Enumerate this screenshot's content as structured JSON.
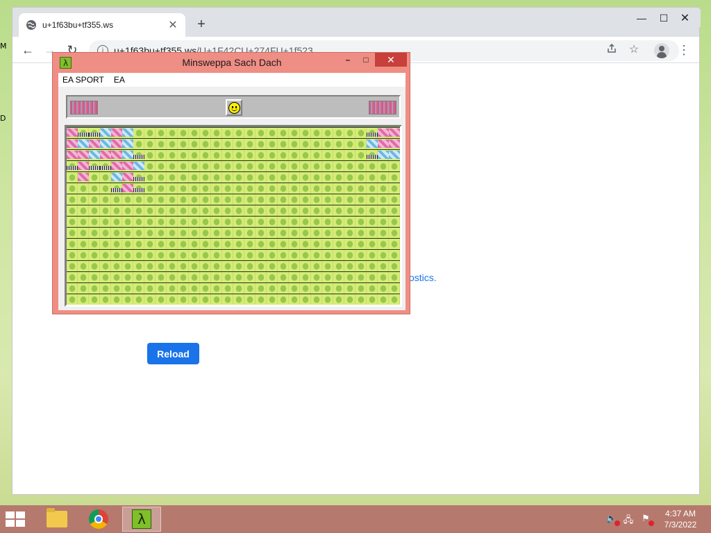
{
  "desktop": {
    "letter_m": "M",
    "letter_d": "D"
  },
  "browser": {
    "tab_title": "u+1f63bu+tf355.ws",
    "tab_close": "✕",
    "new_tab": "+",
    "window_controls": {
      "minimize": "—",
      "maximize": "☐",
      "close": "✕"
    },
    "nav": {
      "back": "←",
      "forward": "→",
      "reload": "↻"
    },
    "url_host": "u+1f63bu+tf355.ws",
    "url_path": "/U+1F42CU+274FU+1f523",
    "menu": "⋮",
    "page": {
      "diagnostics_text": "ostics.",
      "reload_label": "Reload"
    }
  },
  "minesweeper": {
    "title": "Minsweppa Sach Dach",
    "menu": [
      "EA SPORT",
      "EA"
    ],
    "controls": {
      "minimize": "–",
      "maximize": "□",
      "close": "✕"
    },
    "app_icon": "λ",
    "reveal_pattern": [
      {
        "c": 0,
        "r": 0,
        "t": "pink"
      },
      {
        "c": 1,
        "r": 0,
        "t": "num"
      },
      {
        "c": 2,
        "r": 0,
        "t": "num"
      },
      {
        "c": 3,
        "r": 0,
        "t": "blue"
      },
      {
        "c": 4,
        "r": 0,
        "t": "pink"
      },
      {
        "c": 5,
        "r": 0,
        "t": "blue"
      },
      {
        "c": 0,
        "r": 1,
        "t": "pink"
      },
      {
        "c": 1,
        "r": 1,
        "t": "blue"
      },
      {
        "c": 2,
        "r": 1,
        "t": "pink"
      },
      {
        "c": 3,
        "r": 1,
        "t": "blue"
      },
      {
        "c": 4,
        "r": 1,
        "t": "pink"
      },
      {
        "c": 5,
        "r": 1,
        "t": "blue"
      },
      {
        "c": 0,
        "r": 2,
        "t": "pink"
      },
      {
        "c": 1,
        "r": 2,
        "t": "pink"
      },
      {
        "c": 2,
        "r": 2,
        "t": "blue"
      },
      {
        "c": 3,
        "r": 2,
        "t": "pink"
      },
      {
        "c": 4,
        "r": 2,
        "t": "pink"
      },
      {
        "c": 5,
        "r": 2,
        "t": "blue"
      },
      {
        "c": 6,
        "r": 2,
        "t": "num"
      },
      {
        "c": 0,
        "r": 3,
        "t": "num"
      },
      {
        "c": 1,
        "r": 3,
        "t": "pink"
      },
      {
        "c": 2,
        "r": 3,
        "t": "num"
      },
      {
        "c": 3,
        "r": 3,
        "t": "num"
      },
      {
        "c": 4,
        "r": 3,
        "t": "pink"
      },
      {
        "c": 5,
        "r": 3,
        "t": "pink"
      },
      {
        "c": 6,
        "r": 3,
        "t": "blue"
      },
      {
        "c": 1,
        "r": 4,
        "t": "pink"
      },
      {
        "c": 4,
        "r": 4,
        "t": "blue"
      },
      {
        "c": 5,
        "r": 4,
        "t": "pink"
      },
      {
        "c": 6,
        "r": 4,
        "t": "num"
      },
      {
        "c": 4,
        "r": 5,
        "t": "num"
      },
      {
        "c": 5,
        "r": 5,
        "t": "pink"
      },
      {
        "c": 6,
        "r": 5,
        "t": "num"
      },
      {
        "c": 27,
        "r": 0,
        "t": "num"
      },
      {
        "c": 28,
        "r": 0,
        "t": "pink"
      },
      {
        "c": 29,
        "r": 0,
        "t": "pink"
      },
      {
        "c": 27,
        "r": 1,
        "t": "blue"
      },
      {
        "c": 28,
        "r": 1,
        "t": "pink"
      },
      {
        "c": 29,
        "r": 1,
        "t": "pink"
      },
      {
        "c": 27,
        "r": 2,
        "t": "num"
      },
      {
        "c": 28,
        "r": 2,
        "t": "blue"
      },
      {
        "c": 29,
        "r": 2,
        "t": "blue"
      }
    ]
  },
  "taskbar": {
    "time": "4:37 AM",
    "date": "7/3/2022",
    "tray": {
      "volume": "🔈",
      "network": "🖧",
      "flag": "⚑"
    }
  },
  "colors": {
    "accent": "#1a73e8",
    "ms_frame": "#ef8e84",
    "taskbar": "#b5796e"
  }
}
